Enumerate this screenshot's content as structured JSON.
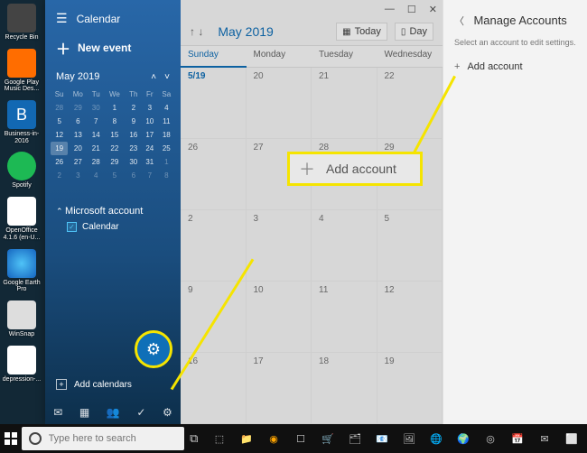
{
  "desktop_icons": [
    {
      "label": "Recycle Bin",
      "bg": "#444"
    },
    {
      "label": "Google Play Music Des...",
      "bg": "#ff6d00"
    },
    {
      "label": "Business-in-2016",
      "bg": "#1268b3"
    },
    {
      "label": "Spotify",
      "bg": "#1db954"
    },
    {
      "label": "OpenOffice 4.1.6 (en-U...",
      "bg": "#fff"
    },
    {
      "label": "Google Earth Pro",
      "bg": "#222"
    },
    {
      "label": "WinSnap",
      "bg": "#ddd"
    },
    {
      "label": "depression-...",
      "bg": "#fff"
    }
  ],
  "app_title": "Calendar",
  "new_event": "New event",
  "mini_month": "May 2019",
  "mini_days": [
    "Su",
    "Mo",
    "Tu",
    "We",
    "Th",
    "Fr",
    "Sa"
  ],
  "mini_weeks": [
    [
      "28",
      "29",
      "30",
      "1",
      "2",
      "3",
      "4"
    ],
    [
      "5",
      "6",
      "7",
      "8",
      "9",
      "10",
      "11"
    ],
    [
      "12",
      "13",
      "14",
      "15",
      "16",
      "17",
      "18"
    ],
    [
      "19",
      "20",
      "21",
      "22",
      "23",
      "24",
      "25"
    ],
    [
      "26",
      "27",
      "28",
      "29",
      "30",
      "31",
      "1"
    ],
    [
      "2",
      "3",
      "4",
      "5",
      "6",
      "7",
      "8"
    ]
  ],
  "accounts_header": "Microsoft account",
  "calendar_item": "Calendar",
  "add_calendars": "Add calendars",
  "toolbar_month": "May 2019",
  "today_btn": "Today",
  "day_btn": "Day",
  "day_headers": [
    "Sunday",
    "Monday",
    "Tuesday",
    "Wednesday"
  ],
  "grid": [
    [
      "5/19",
      "20",
      "21",
      "22"
    ],
    [
      "26",
      "27",
      "28",
      "29"
    ],
    [
      "2",
      "3",
      "4",
      "5"
    ],
    [
      "9",
      "10",
      "11",
      "12"
    ],
    [
      "16",
      "17",
      "18",
      "19"
    ]
  ],
  "right": {
    "title": "Manage Accounts",
    "sub": "Select an account to edit settings.",
    "add": "Add account"
  },
  "callout": "Add account",
  "search_placeholder": "Type here to search"
}
